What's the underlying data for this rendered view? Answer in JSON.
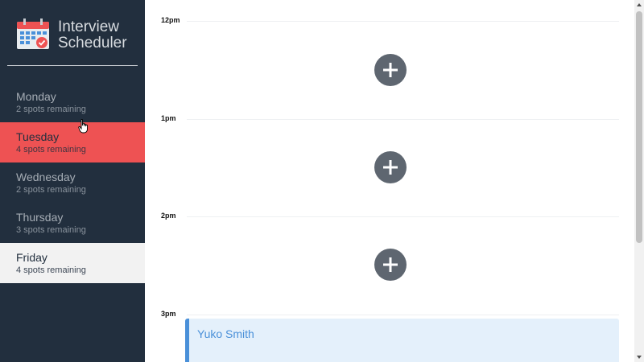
{
  "brand": {
    "name": "Interview Scheduler"
  },
  "days": [
    {
      "name": "Monday",
      "spots": "2 spots remaining",
      "state": "normal"
    },
    {
      "name": "Tuesday",
      "spots": "4 spots remaining",
      "state": "selected"
    },
    {
      "name": "Wednesday",
      "spots": "2 spots remaining",
      "state": "normal"
    },
    {
      "name": "Thursday",
      "spots": "3 spots remaining",
      "state": "normal"
    },
    {
      "name": "Friday",
      "spots": "4 spots remaining",
      "state": "hovered"
    }
  ],
  "schedule": {
    "slots": [
      {
        "time": "12pm"
      },
      {
        "time": "1pm"
      },
      {
        "time": "2pm"
      },
      {
        "time": "3pm"
      }
    ],
    "booked": {
      "student": "Yuko Smith"
    }
  },
  "colors": {
    "sidebar": "#222f3e",
    "selected": "#ee5253",
    "add_button": "#5e6670",
    "booked_accent": "#4a90d9"
  }
}
